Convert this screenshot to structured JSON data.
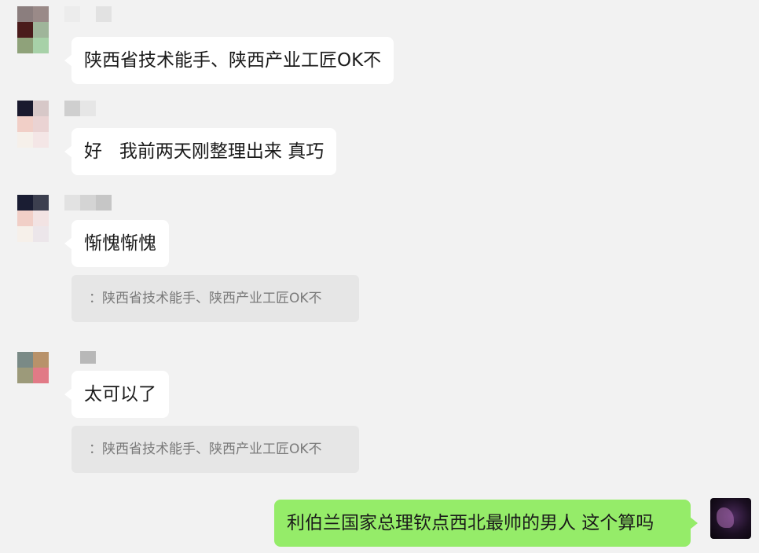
{
  "messages": [
    {
      "text": "陕西省技术能手、陕西产业工匠OK不"
    },
    {
      "text": "好   我前两天刚整理出来 真巧"
    },
    {
      "text": "惭愧惭愧",
      "quote": "：陕西省技术能手、陕西产业工匠OK不"
    },
    {
      "text": "太可以了",
      "quote": "：陕西省技术能手、陕西产业工匠OK不"
    },
    {
      "text": "利伯兰国家总理钦点西北最帅的男人 这个算吗"
    }
  ],
  "colors": {
    "background": "#f2f2f2",
    "incoming_bubble": "#ffffff",
    "outgoing_bubble": "#95ec69",
    "quote_bg": "#e6e6e6"
  }
}
